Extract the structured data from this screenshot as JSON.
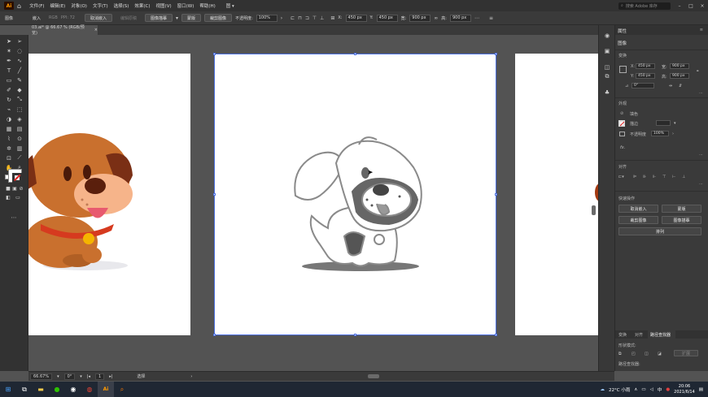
{
  "menubar": {
    "logo": "Ai",
    "items": [
      "文件(F)",
      "编辑(E)",
      "对象(O)",
      "文字(T)",
      "选择(S)",
      "效果(C)",
      "视图(V)",
      "窗口(W)",
      "帮助(H)"
    ],
    "workspace": "图 ▾",
    "search_placeholder": "搜索 Adobe 库存"
  },
  "control": {
    "object_type": "图像",
    "embed_btn": "嵌入",
    "colorspace": "RGB",
    "ppi": "PPI: 72",
    "unembed_btn": "取消嵌入",
    "edit_original_btn": "编辑原稿",
    "trace_btn": "图像描摹",
    "mask_btn": "蒙版",
    "crop_btn": "裁剪图像",
    "opacity_label": "不透明度:",
    "opacity_value": "100%",
    "x_label": "X:",
    "x_value": "450 px",
    "y_label": "Y:",
    "y_value": "450 px",
    "w_label": "宽:",
    "w_value": "900 px",
    "h_label": "高:",
    "h_value": "900 px"
  },
  "doc_tab": {
    "title": "03.ai* @ 66.67 % (RGB/预览)",
    "close": "×"
  },
  "properties": {
    "tabs_title": "属性",
    "obj_type": "图像",
    "transform_title": "变换",
    "x_label": "X:",
    "x_value": "450 px",
    "w_label": "宽:",
    "w_value": "900 px",
    "y_label": "Y:",
    "y_value": "450 px",
    "h_label": "高:",
    "h_value": "900 px",
    "angle": "0°",
    "appearance_title": "外观",
    "fill_label": "填色",
    "stroke_label": "描边",
    "opacity_label": "不透明度",
    "opacity_value": "100%",
    "fx": "fx.",
    "align_title": "对齐",
    "quick_title": "快速操作",
    "btn_unembed": "取消嵌入",
    "btn_mask": "蒙版",
    "btn_crop": "裁剪图像",
    "btn_trace": "图像描摹",
    "btn_arrange": "排列"
  },
  "bottom_panel": {
    "tab_transform": "变换",
    "tab_align": "对齐",
    "tab_pathfinder": "路径查找器",
    "shape_modes": "形状模式:",
    "expand": "扩展",
    "pathfinders": "路径查找器:"
  },
  "status": {
    "zoom": "66.67%",
    "rotate": "0°",
    "artboard": "1",
    "tool": "选择"
  },
  "taskbar": {
    "weather": "22°C 小雨",
    "ime": "中",
    "time": "20:06",
    "date": "2021/6/14"
  },
  "colors": {
    "accent": "#4b6fe0",
    "app_bg": "#535353",
    "panel_bg": "#3a3a3a",
    "dog_brown": "#c9702e",
    "dog_dark": "#7a2f15",
    "collar": "#d63a1f",
    "tag": "#f5b400"
  }
}
